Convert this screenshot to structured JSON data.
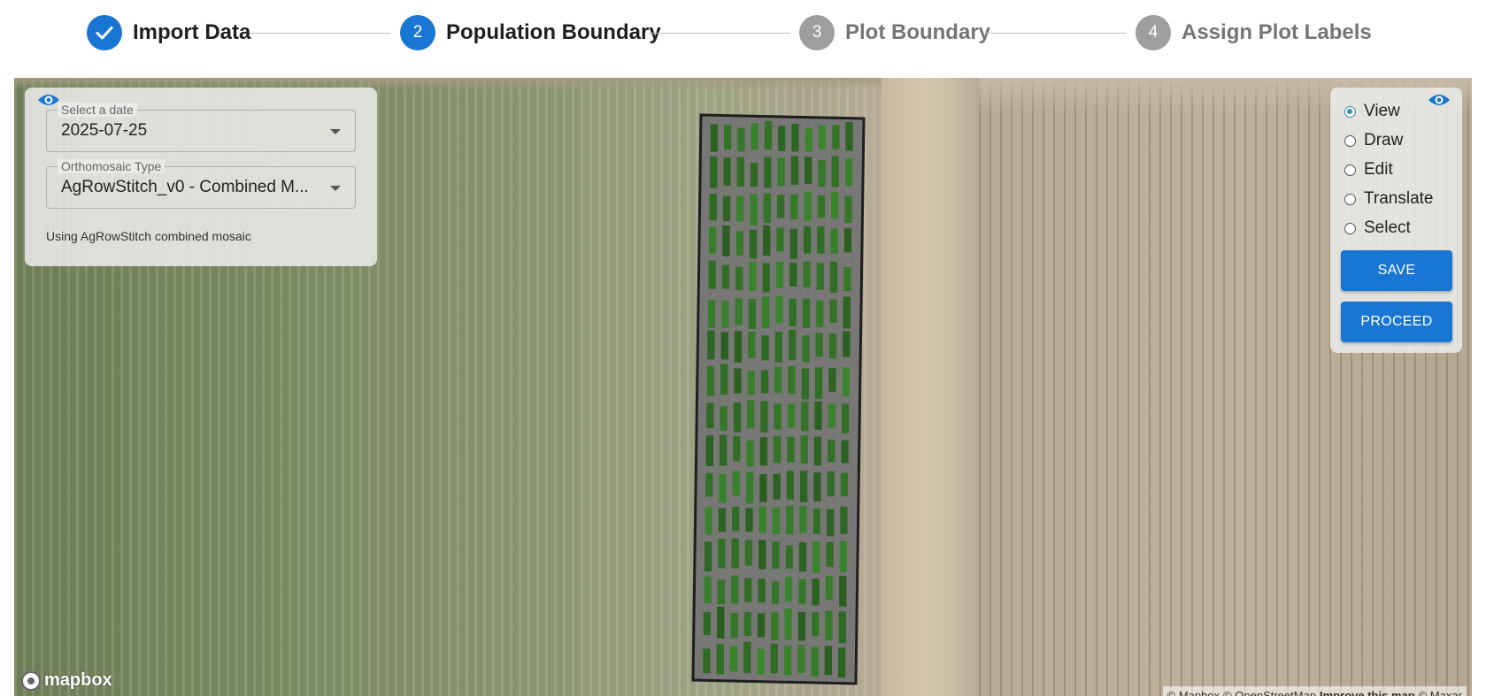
{
  "stepper": {
    "steps": [
      {
        "number": "",
        "label": "Import Data",
        "state": "completed",
        "icon": "check-icon"
      },
      {
        "number": "2",
        "label": "Population Boundary",
        "state": "active"
      },
      {
        "number": "3",
        "label": "Plot Boundary",
        "state": "pending"
      },
      {
        "number": "4",
        "label": "Assign Plot Labels",
        "state": "pending"
      }
    ]
  },
  "left_panel": {
    "toggle_icon": "eye-icon",
    "date_select": {
      "label": "Select a date",
      "value": "2025-07-25"
    },
    "mosaic_select": {
      "label": "Orthomosaic Type",
      "value": "AgRowStitch_v0 - Combined M..."
    },
    "helper_text": "Using AgRowStitch combined mosaic"
  },
  "right_panel": {
    "toggle_icon": "eye-icon",
    "modes": [
      {
        "label": "View",
        "checked": true
      },
      {
        "label": "Draw",
        "checked": false
      },
      {
        "label": "Edit",
        "checked": false
      },
      {
        "label": "Translate",
        "checked": false
      },
      {
        "label": "Select",
        "checked": false
      }
    ],
    "save_label": "SAVE",
    "proceed_label": "PROCEED"
  },
  "map": {
    "logo_text": "mapbox",
    "attribution": {
      "mapbox": "© Mapbox",
      "osm": "© OpenStreetMap",
      "improve": "Improve this map",
      "maxar": "© Maxar"
    }
  },
  "colors": {
    "primary": "#1976d2",
    "pending": "#9e9e9e",
    "radio_checked": "#3b8fb8"
  }
}
